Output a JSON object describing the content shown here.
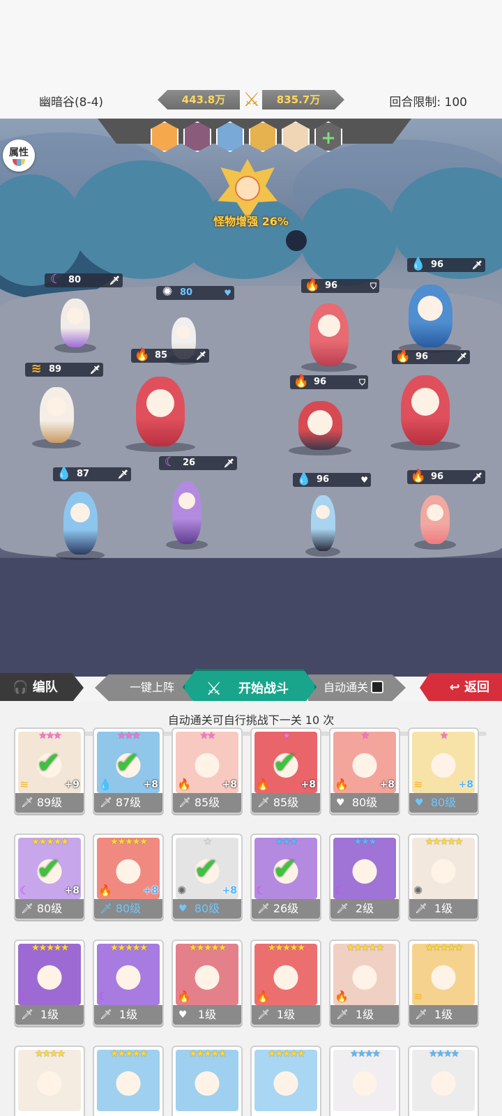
{
  "header": {
    "stage": "幽暗谷(8-4)",
    "my_power": "443.8万",
    "enemy_power": "835.7万",
    "round_limit": "回合限制: 100"
  },
  "battle": {
    "attr_button": "属性",
    "boss_label": "怪物增强 26%",
    "team_add": "+",
    "units": [
      {
        "side": "ally",
        "element": "moon",
        "value": "80",
        "type": "sword"
      },
      {
        "side": "ally",
        "element": "sun",
        "value": "80",
        "type": "heart"
      },
      {
        "side": "ally",
        "element": "wind",
        "value": "89",
        "type": "sword"
      },
      {
        "side": "ally",
        "element": "fire",
        "value": "85",
        "type": "sword"
      },
      {
        "side": "ally",
        "element": "water",
        "value": "87",
        "type": "sword"
      },
      {
        "side": "ally",
        "element": "moon",
        "value": "26",
        "type": "sword"
      },
      {
        "side": "enemy",
        "element": "fire",
        "value": "96",
        "type": "shield"
      },
      {
        "side": "enemy",
        "element": "water",
        "value": "96",
        "type": "sword"
      },
      {
        "side": "enemy",
        "element": "fire",
        "value": "96",
        "type": "shield"
      },
      {
        "side": "enemy",
        "element": "fire",
        "value": "96",
        "type": "sword"
      },
      {
        "side": "enemy",
        "element": "water",
        "value": "96",
        "type": "heart"
      },
      {
        "side": "enemy",
        "element": "fire",
        "value": "96",
        "type": "sword"
      }
    ]
  },
  "actions": {
    "team": "编队",
    "auto_deploy": "一键上阵",
    "start": "开始战斗",
    "auto_clear": "自动通关",
    "back": "返回"
  },
  "roster": {
    "auto_info": "自动通关可自行挑战下一关 10 次",
    "cards": [
      {
        "stars": "★★★",
        "star_color": "#ff6fd0",
        "plus": "+9",
        "level": "89级",
        "type": "sword",
        "elem": "wind",
        "checked": true,
        "color": "#f3e6d6"
      },
      {
        "stars": "★★★",
        "star_color": "#ff6fd0",
        "plus": "+8",
        "level": "87级",
        "type": "sword",
        "elem": "water",
        "checked": true,
        "color": "#8fc6ea"
      },
      {
        "stars": "★★",
        "star_color": "#ff6fd0",
        "plus": "+8",
        "level": "85级",
        "type": "sword",
        "elem": "fire",
        "checked": false,
        "color": "#f7c9c0"
      },
      {
        "stars": "★",
        "star_color": "#ff6fd0",
        "plus": "+8",
        "level": "85级",
        "type": "sword",
        "elem": "fire",
        "checked": true,
        "color": "#e9656a"
      },
      {
        "stars": "★",
        "star_color": "#ff6fd0",
        "plus": "+8",
        "level": "80级",
        "type": "heart",
        "elem": "fire",
        "checked": false,
        "color": "#f3a59c"
      },
      {
        "stars": "★",
        "star_color": "#ff6fd0",
        "plus": "+8",
        "level": "80级",
        "type": "heart",
        "elem": "wind",
        "checked": false,
        "color": "#f7e2a8",
        "blue": true
      },
      {
        "stars": "★★★★★",
        "star_color": "#ffd83a",
        "plus": "+8",
        "level": "80级",
        "type": "sword",
        "elem": "moon",
        "checked": true,
        "color": "#c8a6ec"
      },
      {
        "stars": "★★★★★",
        "star_color": "#ffd83a",
        "plus": "+8",
        "level": "80级",
        "type": "sword",
        "elem": "fire",
        "checked": false,
        "color": "#f08a80",
        "blue": true
      },
      {
        "stars": "★",
        "star_color": "#dddddd",
        "plus": "+8",
        "level": "80级",
        "type": "heart",
        "elem": "sun",
        "checked": true,
        "color": "#e4e4e4",
        "blue": true
      },
      {
        "stars": "★★★",
        "star_color": "#57b8ff",
        "plus": "",
        "level": "26级",
        "type": "sword",
        "elem": "moon",
        "checked": true,
        "color": "#b48ae0"
      },
      {
        "stars": "★★★",
        "star_color": "#57b8ff",
        "plus": "",
        "level": "2级",
        "type": "sword",
        "elem": "moon",
        "checked": false,
        "color": "#9f74d6"
      },
      {
        "stars": "★★★★★",
        "star_color": "#ffd83a",
        "plus": "",
        "level": "1级",
        "type": "sword",
        "elem": "sun",
        "checked": false,
        "color": "#f2e8de"
      },
      {
        "stars": "★★★★★",
        "star_color": "#ffd83a",
        "plus": "",
        "level": "1级",
        "type": "sword",
        "elem": "moon",
        "checked": false,
        "color": "#9c6ad2"
      },
      {
        "stars": "★★★★★",
        "star_color": "#ffd83a",
        "plus": "",
        "level": "1级",
        "type": "sword",
        "elem": "moon",
        "checked": false,
        "color": "#a77be0"
      },
      {
        "stars": "★★★★★",
        "star_color": "#ffd83a",
        "plus": "",
        "level": "1级",
        "type": "heart",
        "elem": "fire",
        "checked": false,
        "color": "#e4808a"
      },
      {
        "stars": "★★★★★",
        "star_color": "#ffd83a",
        "plus": "",
        "level": "1级",
        "type": "sword",
        "elem": "fire",
        "checked": false,
        "color": "#ec6f6f"
      },
      {
        "stars": "★★★★★",
        "star_color": "#ffd83a",
        "plus": "",
        "level": "1级",
        "type": "sword",
        "elem": "fire",
        "checked": false,
        "color": "#f0d0c2"
      },
      {
        "stars": "★★★★★",
        "star_color": "#ffd83a",
        "plus": "",
        "level": "1级",
        "type": "sword",
        "elem": "wind",
        "checked": false,
        "color": "#f5d38e"
      },
      {
        "stars": "★★★★",
        "star_color": "#ffd83a",
        "plus": "",
        "level": "",
        "type": "",
        "elem": "",
        "checked": false,
        "color": "#f4ece0"
      },
      {
        "stars": "★★★★★",
        "star_color": "#ffd83a",
        "plus": "",
        "level": "",
        "type": "",
        "elem": "",
        "checked": false,
        "color": "#9fd0ef"
      },
      {
        "stars": "★★★★★",
        "star_color": "#ffd83a",
        "plus": "",
        "level": "",
        "type": "",
        "elem": "",
        "checked": false,
        "color": "#9fd0ef"
      },
      {
        "stars": "★★★★★",
        "star_color": "#ffd83a",
        "plus": "",
        "level": "",
        "type": "",
        "elem": "",
        "checked": false,
        "color": "#a9d6f2"
      },
      {
        "stars": "★★★★",
        "star_color": "#57b8ff",
        "plus": "",
        "level": "",
        "type": "",
        "elem": "",
        "checked": false,
        "color": "#f0eef0"
      },
      {
        "stars": "★★★★",
        "star_color": "#57b8ff",
        "plus": "",
        "level": "",
        "type": "",
        "elem": "",
        "checked": false,
        "color": "#ececec"
      }
    ]
  },
  "icons": {
    "moon": "☾",
    "sun": "✺",
    "wind": "≋",
    "fire": "🔥",
    "water": "💧",
    "sword": "🗡",
    "heart": "♥",
    "shield": "⛉"
  }
}
